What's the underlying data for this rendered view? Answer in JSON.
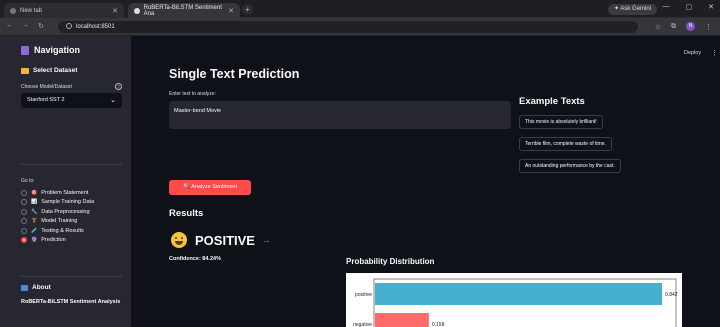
{
  "browser": {
    "tabs": [
      {
        "label": "New tab",
        "active": false
      },
      {
        "label": "RoBERTa-BiLSTM Sentiment Ana",
        "active": true
      }
    ],
    "gemini_label": "Ask Gemini",
    "url": "localhost:8501",
    "profile_initial": "N"
  },
  "header": {
    "deploy_label": "Deploy"
  },
  "sidebar": {
    "title": "Navigation",
    "dataset_header": "Select Dataset",
    "model_label": "Choose Model/Dataset",
    "model_value": "Stanford SST 2",
    "goto_label": "Go to:",
    "nav_items": [
      {
        "icon": "🎯",
        "label": "Problem Statement",
        "selected": false
      },
      {
        "icon": "📊",
        "label": "Sample Training Data",
        "selected": false
      },
      {
        "icon": "🔧",
        "label": "Data Preprocessing",
        "selected": false
      },
      {
        "icon": "🏋",
        "label": "Model Training",
        "selected": false
      },
      {
        "icon": "🧪",
        "label": "Testing & Results",
        "selected": false
      },
      {
        "icon": "🔮",
        "label": "Prediction",
        "selected": true
      }
    ],
    "about_header": "About",
    "about_text": "RoBERTa-BiLSTM Sentiment Analysis"
  },
  "main": {
    "title": "Single Text Prediction",
    "input_label": "Enter text to analyze:",
    "input_value": "Master-bend Movie",
    "examples_title": "Example Texts",
    "examples": [
      "This movie is absolutely brilliant!",
      "Terrible film, complete waste of time.",
      "An outstanding performance by the cast."
    ],
    "analyze_label": "Analyze Sentiment",
    "results_title": "Results",
    "sentiment": "POSITIVE",
    "confidence": "Confidence: 84.24%",
    "prob_title": "Probability Distribution"
  },
  "chart_data": {
    "type": "bar",
    "orientation": "horizontal",
    "categories": [
      "positive",
      "negative"
    ],
    "values": [
      0.842,
      0.158
    ],
    "value_labels": [
      "0.842",
      "0.158"
    ],
    "colors": [
      "#45b0ce",
      "#ff6b6b"
    ],
    "xlim": [
      0,
      0.88
    ]
  }
}
